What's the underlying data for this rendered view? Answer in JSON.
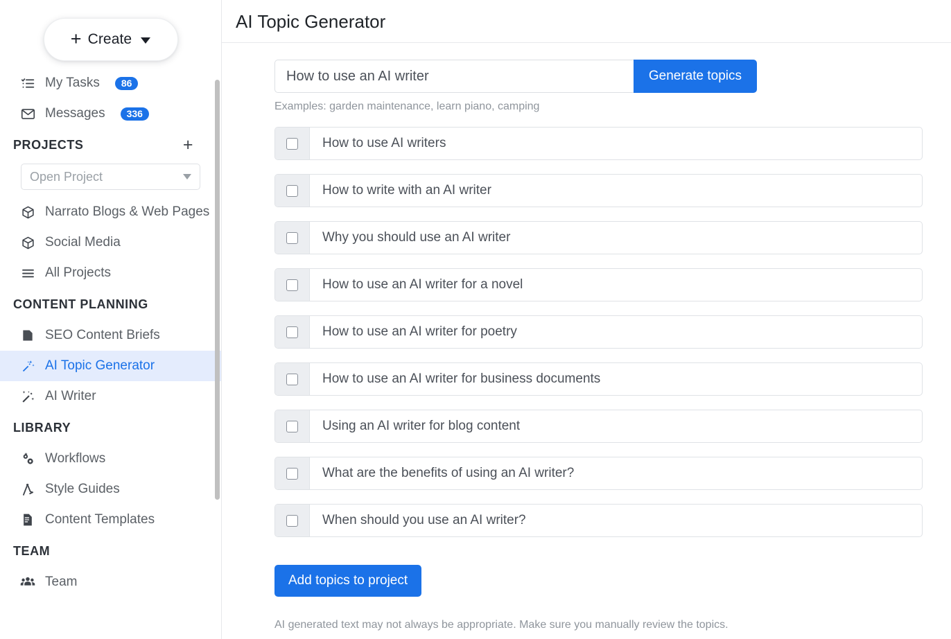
{
  "sidebar": {
    "create_button": {
      "label": "Create",
      "plus_icon": "plus-icon",
      "caret_icon": "chevron-down-icon"
    },
    "quick_items": [
      {
        "label": "My Tasks",
        "badge": "86",
        "icon": "task-list-icon"
      },
      {
        "label": "Messages",
        "badge": "336",
        "icon": "envelope-icon"
      }
    ],
    "sections": [
      {
        "title": "PROJECTS",
        "action_icon": "plus-icon",
        "select": {
          "placeholder": "Open Project",
          "caret_icon": "chevron-down-icon"
        },
        "items": [
          {
            "label": "Narrato Blogs & Web Pages",
            "icon": "cube-icon",
            "active": false
          },
          {
            "label": "Social Media",
            "icon": "cube-icon",
            "active": false
          },
          {
            "label": "All Projects",
            "icon": "hamburger-icon",
            "active": false
          }
        ]
      },
      {
        "title": "CONTENT PLANNING",
        "items": [
          {
            "label": "SEO Content Briefs",
            "icon": "document-icon",
            "active": false
          },
          {
            "label": "AI Topic Generator",
            "icon": "magic-wand-icon",
            "active": true
          },
          {
            "label": "AI Writer",
            "icon": "magic-wand-sparkle-icon",
            "active": false
          }
        ]
      },
      {
        "title": "LIBRARY",
        "items": [
          {
            "label": "Workflows",
            "icon": "gears-icon",
            "active": false
          },
          {
            "label": "Style Guides",
            "icon": "compass-icon",
            "active": false
          },
          {
            "label": "Content Templates",
            "icon": "file-text-icon",
            "active": false
          }
        ]
      },
      {
        "title": "TEAM",
        "items": [
          {
            "label": "Team",
            "icon": "people-icon",
            "active": false
          }
        ]
      }
    ]
  },
  "main": {
    "page_title": "AI Topic Generator",
    "search": {
      "value": "How to use an AI writer",
      "placeholder": "Enter a topic",
      "button_label": "Generate topics"
    },
    "examples_text": "Examples: garden maintenance, learn piano, camping",
    "topics": [
      {
        "text": "How to use AI writers",
        "checked": false
      },
      {
        "text": "How to write with an AI writer",
        "checked": false
      },
      {
        "text": "Why you should use an AI writer",
        "checked": false
      },
      {
        "text": "How to use an AI writer for a novel",
        "checked": false
      },
      {
        "text": "How to use an AI writer for poetry",
        "checked": false
      },
      {
        "text": "How to use an AI writer for business documents",
        "checked": false
      },
      {
        "text": "Using an AI writer for blog content",
        "checked": false
      },
      {
        "text": "What are the benefits of using an AI writer?",
        "checked": false
      },
      {
        "text": "When should you use an AI writer?",
        "checked": false
      }
    ],
    "add_button_label": "Add topics to project",
    "footnote": "AI generated text may not always be appropriate. Make sure you manually review the topics."
  },
  "colors": {
    "accent_blue": "#1b72e8",
    "active_row_bg": "#e4ecfd",
    "checkbox_cell_bg": "#eceef1",
    "muted_text": "#8f959c",
    "body_text": "#4b5058"
  }
}
